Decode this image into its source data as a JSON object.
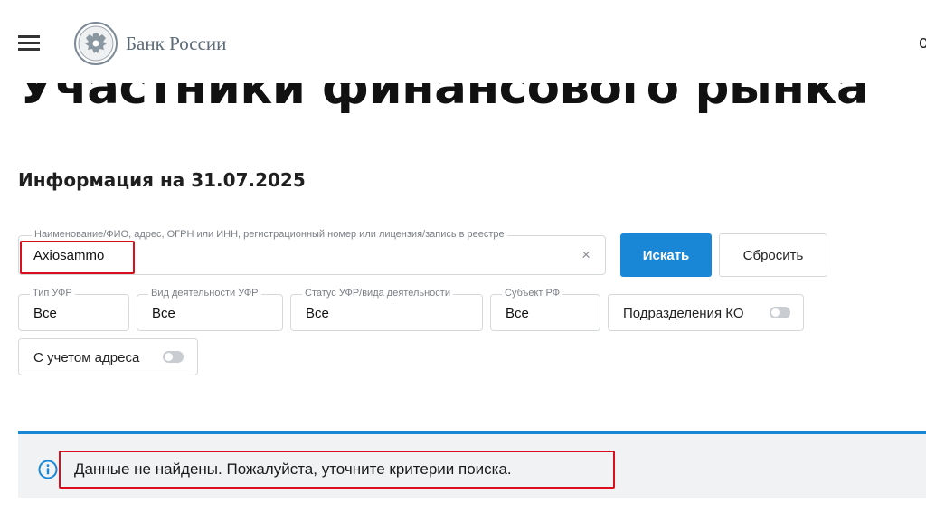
{
  "header": {
    "brand": "Банк России",
    "right_cut": "с"
  },
  "page": {
    "title": "Участники финансового рынка",
    "info_date": "Информация на 31.07.2025"
  },
  "search": {
    "label": "Наименование/ФИО, адрес, ОГРН или ИНН, регистрационный номер или лицензия/запись в реестре",
    "value": "Axiosammo",
    "clear_glyph": "×",
    "search_label": "Искать",
    "reset_label": "Сбросить"
  },
  "filters": [
    {
      "label": "Тип УФР",
      "value": "Все"
    },
    {
      "label": "Вид деятельности УФР",
      "value": "Все"
    },
    {
      "label": "Статус УФР/вида деятельности",
      "value": "Все"
    },
    {
      "label": "Субъект РФ",
      "value": "Все"
    }
  ],
  "toggles": {
    "ko_divisions": {
      "label": "Подразделения КО",
      "on": false
    },
    "with_address": {
      "label": "С учетом адреса",
      "on": false
    }
  },
  "result": {
    "icon": "info-icon",
    "message": "Данные не найдены. Пожалуйста, уточните критерии поиска."
  },
  "colors": {
    "accent": "#1a87d6",
    "highlight": "#d90f1e",
    "notice_bg": "#f1f2f4"
  }
}
